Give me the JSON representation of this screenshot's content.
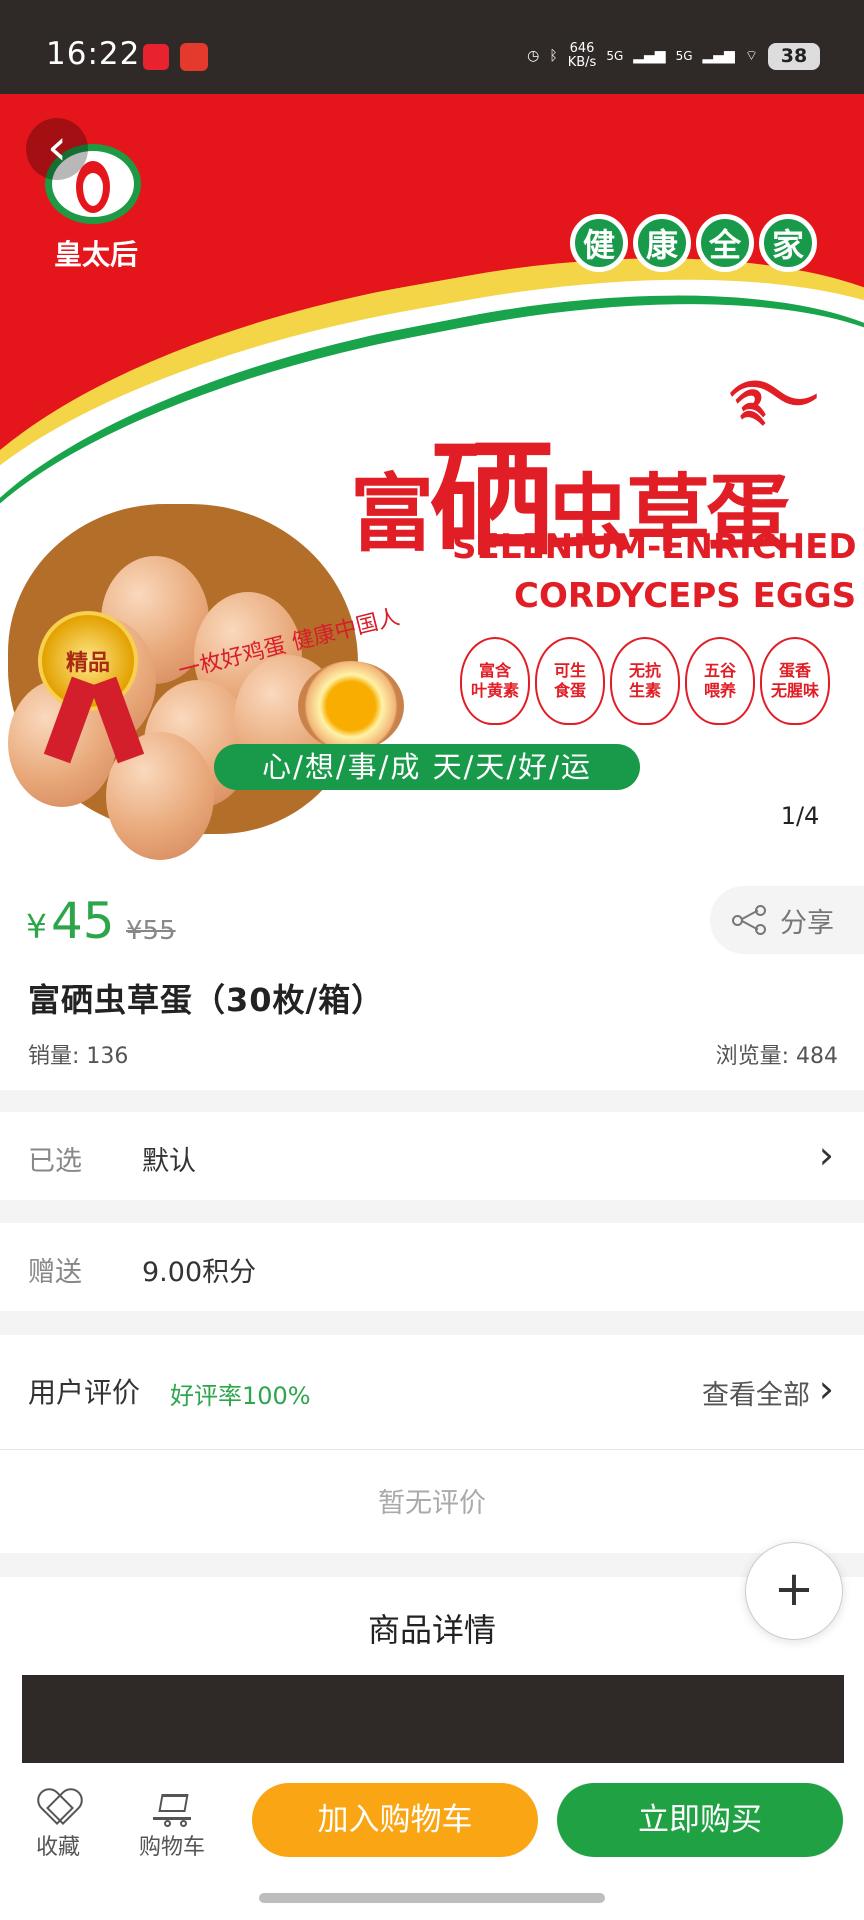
{
  "status": {
    "time": "16:22",
    "network_speed_value": "646",
    "network_speed_unit": "KB/s",
    "signal_1": "5G",
    "signal_2": "5G",
    "battery": "38"
  },
  "gallery": {
    "brand_logo_text": "皇太后",
    "health_words": [
      "健",
      "康",
      "全",
      "家"
    ],
    "headline_1": "富",
    "headline_2": "硒",
    "headline_3": "虫草蛋",
    "english_line_1": "SELENIUM-ENRICHED",
    "english_line_2": "CORDYCEPS EGGS",
    "medal_text": "精品",
    "calligraphy": "一枚好鸡蛋  健康中国人",
    "features": [
      "富含\n叶黄素",
      "可生\n食蛋",
      "无抗\n生素",
      "五谷\n喂养",
      "蛋香\n无腥味"
    ],
    "slogan": "心/想/事/成   天/天/好/运",
    "counter": "1/4"
  },
  "product": {
    "currency": "¥",
    "price": "45",
    "old_price": "¥55",
    "share_label": "分享",
    "title": "富硒虫草蛋（30枚/箱）",
    "sales": "销量: 136",
    "views": "浏览量: 484"
  },
  "options": {
    "selected_label": "已选",
    "selected_value": "默认",
    "gift_label": "赠送",
    "gift_value": "9.00积分"
  },
  "reviews": {
    "title": "用户评价",
    "positive_rate": "好评率100%",
    "see_all": "查看全部",
    "empty": "暂无评价"
  },
  "details": {
    "title": "商品详情"
  },
  "bottom_bar": {
    "favorite_label": "收藏",
    "cart_label": "购物车",
    "add_to_cart_label": "加入购物车",
    "buy_now_label": "立即购买"
  },
  "colors": {
    "price_green": "#2da64b",
    "buy_green": "#20a244",
    "cart_orange": "#faa514",
    "banner_red": "#e4161c"
  },
  "icons": {
    "back": "chevron-left-icon",
    "share": "share-icon",
    "chevron": "chevron-right-icon",
    "add": "plus-icon",
    "favorite": "heart-icon",
    "cart": "shopping-cart-icon"
  }
}
